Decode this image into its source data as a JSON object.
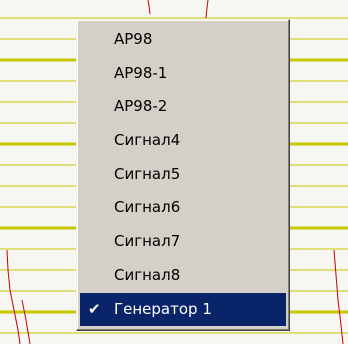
{
  "menu": {
    "items": [
      {
        "label": "AP98"
      },
      {
        "label": "AP98-1"
      },
      {
        "label": "AP98-2"
      },
      {
        "label": "Сигнал4"
      },
      {
        "label": "Сигнал5"
      },
      {
        "label": "Сигнал6"
      },
      {
        "label": "Сигнал7"
      },
      {
        "label": "Сигнал8"
      },
      {
        "label": "Генератор 1",
        "checked": true,
        "check_icon": "✔"
      }
    ]
  },
  "colors": {
    "grid_yellow": "#c8c800",
    "trace_red": "#c80000",
    "menu_bg": "#d4d0c8",
    "highlight": "#0a246a"
  }
}
